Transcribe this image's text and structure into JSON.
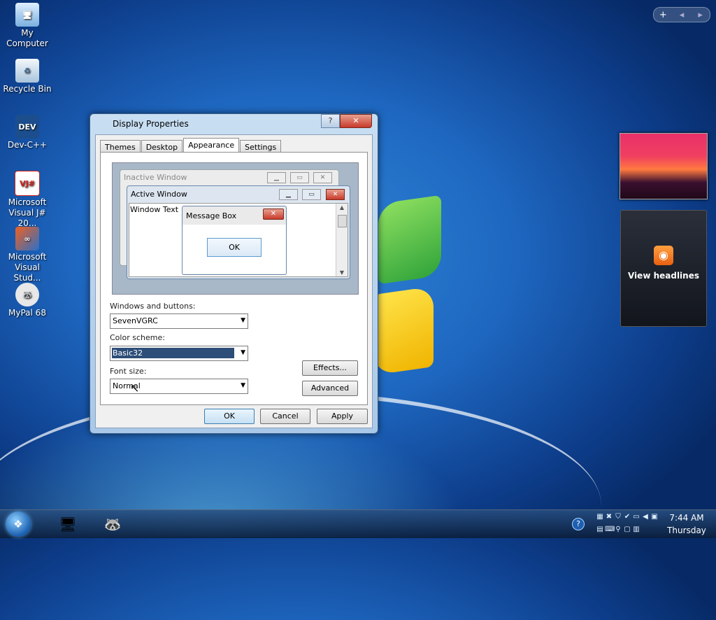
{
  "desktop": {
    "icons": [
      {
        "label_line1": "My Computer",
        "label_line2": ""
      },
      {
        "label_line1": "Recycle Bin",
        "label_line2": ""
      },
      {
        "label_line1": "Dev-C++",
        "label_line2": ""
      },
      {
        "label_line1": "Microsoft",
        "label_line2": "Visual J# 20..."
      },
      {
        "label_line1": "Microsoft",
        "label_line2": "Visual Stud..."
      },
      {
        "label_line1": "MyPal 68",
        "label_line2": ""
      }
    ],
    "gadget_controls": {
      "add": "+",
      "prev": "◂",
      "next": "▸"
    },
    "feed_gadget": {
      "label": "View headlines"
    }
  },
  "dialog": {
    "title": "Display Properties",
    "help_btn": "?",
    "close_btn": "✕",
    "tabs": [
      "Themes",
      "Desktop",
      "Appearance",
      "Settings"
    ],
    "active_tab": "Appearance",
    "preview": {
      "inactive_title": "Inactive Window",
      "active_title": "Active Window",
      "window_text": "Window Text",
      "message_title": "Message Box",
      "message_ok": "OK"
    },
    "windows_buttons": {
      "label": "Windows and buttons:",
      "value": "SevenVGRC"
    },
    "color_scheme": {
      "label": "Color scheme:",
      "value": "Basic32"
    },
    "font_size": {
      "label": "Font size:",
      "value": "Normal"
    },
    "effects_btn": "Effects...",
    "advanced_btn": "Advanced",
    "ok_btn": "OK",
    "cancel_btn": "Cancel",
    "apply_btn": "Apply"
  },
  "taskbar": {
    "start_icon": "windows-orb",
    "help_icon": "?",
    "time": "7:44 AM",
    "day": "Thursday"
  }
}
